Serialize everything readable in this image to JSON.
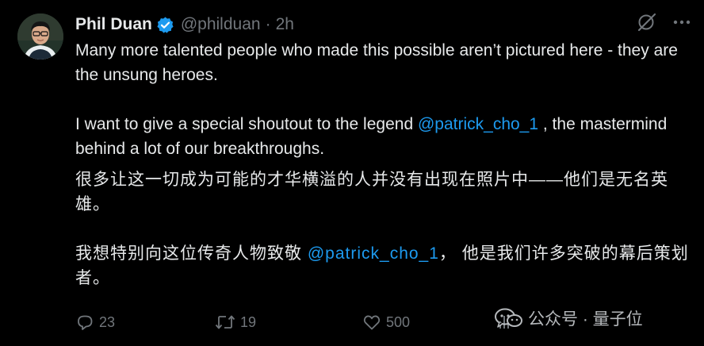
{
  "author": {
    "name": "Phil Duan",
    "handle": "@philduan",
    "separator": "·",
    "time": "2h"
  },
  "tweet": {
    "p1": "Many more talented people who made this possible aren’t pictured here - they are the unsung heroes.",
    "p2_before": "I want to give a special shoutout to the legend ",
    "p2_mention": "@patrick_cho_1",
    "p2_after": " , the mastermind behind a lot of our breakthroughs.",
    "zh1": "很多让这一切成为可能的才华横溢的人并没有出现在照片中——他们是无名英雄。",
    "zh2_before": "我想特别向这位传奇人物致敬 ",
    "zh2_mention": "@patrick_cho_1",
    "zh2_after": "， 他是我们许多突破的幕后策划者。"
  },
  "actions": {
    "reply_count": "23",
    "retweet_count": "19",
    "like_count": "500"
  },
  "watermark": {
    "text": "公众号 · 量子位"
  },
  "icons": {
    "verified": "verified-badge-icon",
    "grok": "grok-icon",
    "more": "more-icon",
    "reply": "reply-icon",
    "retweet": "retweet-icon",
    "like": "like-icon"
  },
  "colors": {
    "background": "#000000",
    "text": "#e7e9ea",
    "secondary": "#71767b",
    "accent": "#1d9bf0"
  }
}
